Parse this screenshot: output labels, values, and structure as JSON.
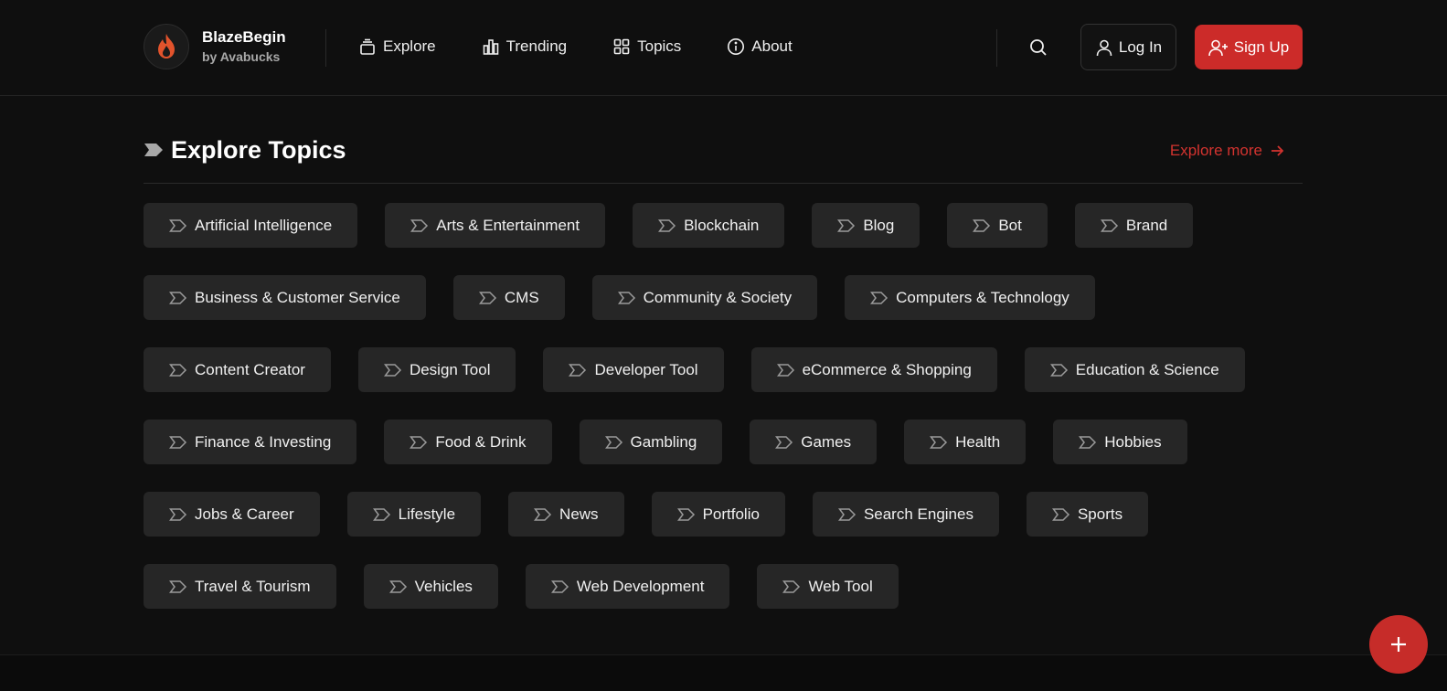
{
  "brand": {
    "name": "BlazeBegin",
    "sub": "by Avabucks",
    "accent": "#cc2b29"
  },
  "nav": [
    {
      "label": "Explore",
      "icon": "stack-icon"
    },
    {
      "label": "Trending",
      "icon": "bar-chart-icon"
    },
    {
      "label": "Topics",
      "icon": "grid-icon"
    },
    {
      "label": "About",
      "icon": "info-icon"
    }
  ],
  "actions": {
    "login": "Log In",
    "signup": "Sign Up"
  },
  "section": {
    "title": "Explore Topics",
    "more": "Explore more"
  },
  "topics": [
    [
      "Artificial Intelligence",
      "Arts & Entertainment",
      "Blockchain",
      "Blog",
      "Bot",
      "Brand"
    ],
    [
      "Business & Customer Service",
      "CMS",
      "Community & Society",
      "Computers & Technology"
    ],
    [
      "Content Creator",
      "Design Tool",
      "Developer Tool",
      "eCommerce & Shopping",
      "Education & Science"
    ],
    [
      "Finance & Investing",
      "Food & Drink",
      "Gambling",
      "Games",
      "Health",
      "Hobbies"
    ],
    [
      "Jobs & Career",
      "Lifestyle",
      "News",
      "Portfolio",
      "Search Engines",
      "Sports"
    ],
    [
      "Travel & Tourism",
      "Vehicles",
      "Web Development",
      "Web Tool"
    ]
  ]
}
